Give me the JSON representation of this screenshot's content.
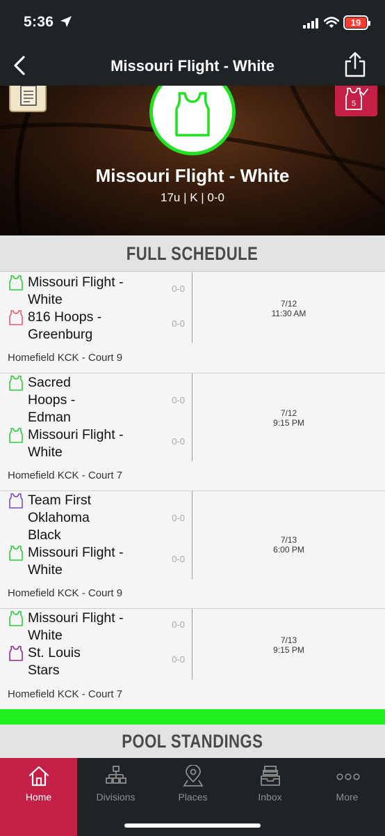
{
  "status_bar": {
    "time": "5:36",
    "battery": "19"
  },
  "nav": {
    "title": "Missouri Flight - White"
  },
  "team": {
    "name": "Missouri Flight - White",
    "meta": "17u | K | 0-0",
    "badge_count": "5"
  },
  "schedule": {
    "header": "FULL SCHEDULE",
    "games": [
      {
        "team1": "Missouri Flight - White",
        "team1_score": "0-0",
        "team1_color": "#2ecc40",
        "team2": "816 Hoops - Greenburg",
        "team2_score": "0-0",
        "team2_color": "#e65a7a",
        "date": "7/12",
        "time": "11:30 AM",
        "location": "Homefield KCK - Court 9"
      },
      {
        "team1": "Sacred Hoops - Edman",
        "team1_score": "0-0",
        "team1_color": "#2ecc40",
        "team2": "Missouri Flight - White",
        "team2_score": "0-0",
        "team2_color": "#2ecc40",
        "date": "7/12",
        "time": "9:15 PM",
        "location": "Homefield KCK - Court 7"
      },
      {
        "team1": "Team First Oklahoma Black",
        "team1_score": "0-0",
        "team1_color": "#7b4bc4",
        "team2": "Missouri Flight - White",
        "team2_score": "0-0",
        "team2_color": "#2ecc40",
        "date": "7/13",
        "time": "6:00 PM",
        "location": "Homefield KCK - Court 9"
      },
      {
        "team1": "Missouri Flight - White",
        "team1_score": "0-0",
        "team1_color": "#2ecc40",
        "team2": "St. Louis Stars",
        "team2_score": "0-0",
        "team2_color": "#8e2a8e",
        "date": "7/13",
        "time": "9:15 PM",
        "location": "Homefield KCK - Court 7"
      }
    ]
  },
  "standings": {
    "header": "POOL STANDINGS"
  },
  "tabs": [
    {
      "label": "Home",
      "icon": "home-icon"
    },
    {
      "label": "Divisions",
      "icon": "divisions-icon"
    },
    {
      "label": "Places",
      "icon": "location-pin-icon"
    },
    {
      "label": "Inbox",
      "icon": "inbox-icon"
    },
    {
      "label": "More",
      "icon": "more-icon"
    }
  ],
  "colors": {
    "accent": "#c41f47",
    "logo_green": "#22e022",
    "bar_green": "#1ef11e",
    "chrome": "#202326"
  }
}
